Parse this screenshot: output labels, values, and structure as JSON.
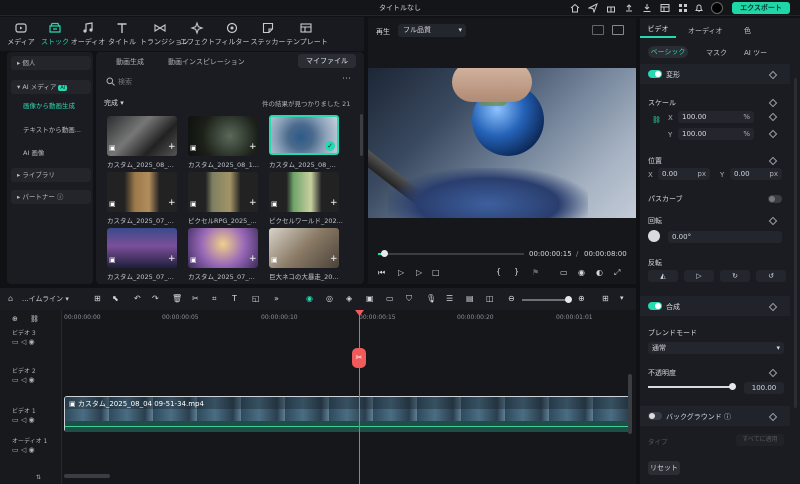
{
  "app": {
    "title": "タイトルなし",
    "export_label": "エクスポート"
  },
  "toolbar": {
    "tools": [
      {
        "label": "メディア",
        "icon": "media-icon"
      },
      {
        "label": "ストック",
        "icon": "stock-icon",
        "active": true
      },
      {
        "label": "オーディオ",
        "icon": "music-icon"
      },
      {
        "label": "タイトル",
        "icon": "title-icon"
      },
      {
        "label": "トランジション",
        "icon": "transition-icon"
      },
      {
        "label": "エフェクト",
        "icon": "effect-icon"
      },
      {
        "label": "フィルター",
        "icon": "filter-icon"
      },
      {
        "label": "ステッカー",
        "icon": "sticker-icon"
      },
      {
        "label": "テンプレート",
        "icon": "template-icon"
      }
    ]
  },
  "left_panel": {
    "items": [
      {
        "label": "個人",
        "type": "header"
      },
      {
        "label": "AI メディア",
        "badge": "AI",
        "type": "header"
      },
      {
        "label": "画像から動画生成",
        "type": "sub",
        "active": true
      },
      {
        "label": "テキストから動画...",
        "type": "sub"
      },
      {
        "label": "AI 画像",
        "type": "sub"
      },
      {
        "label": "ライブラリ",
        "type": "header"
      },
      {
        "label": "パートナー",
        "type": "header"
      }
    ]
  },
  "media_panel": {
    "tabs": [
      "動画生成",
      "動画インスピレーション",
      "マイファイル"
    ],
    "search_placeholder": "検索",
    "section_title": "完成",
    "result_count": "件の結果が見つかりました 21",
    "items": [
      {
        "label": "カスタム_2025_08_..."
      },
      {
        "label": "カスタム_2025_08_1..."
      },
      {
        "label": "カスタム_2025_08_..."
      },
      {
        "label": "カスタム_2025_07_..."
      },
      {
        "label": "ピクセルRPG_2025_..."
      },
      {
        "label": "ピクセルワールド_202..."
      },
      {
        "label": "カスタム_2025_07_..."
      },
      {
        "label": "カスタム_2025_07_..."
      },
      {
        "label": "巨大ネコの大暴走_20..."
      }
    ]
  },
  "player": {
    "play_label": "再生",
    "quality": "フル品質",
    "current_time": "00:00:00:15",
    "total_time": "00:00:08:00",
    "progress": 0.04
  },
  "properties": {
    "tabs": [
      "ビデオ",
      "オーディオ",
      "色"
    ],
    "subtabs": [
      "ベーシック",
      "マスク",
      "AI ツー"
    ],
    "transform": {
      "title": "変形",
      "scale_label": "スケール",
      "x_label": "X",
      "x_value": "100.00",
      "x_unit": "%",
      "y_label": "Y",
      "y_value": "100.00",
      "y_unit": "%",
      "position_label": "位置",
      "pos_x_label": "X",
      "pos_x": "0.00",
      "pos_x_unit": "px",
      "pos_y_label": "Y",
      "pos_y": "0.00",
      "pos_y_unit": "px",
      "path_curve_label": "パスカーブ",
      "rotate_label": "回転",
      "rotate_value": "0.00°",
      "flip_label": "反転"
    },
    "composite": {
      "title": "合成",
      "blend_label": "ブレンドモード",
      "blend_value": "通常",
      "opacity_label": "不透明度",
      "opacity_value": "100.00",
      "opacity_level": 1.0
    },
    "background": {
      "title": "バックグラウンド",
      "type_label": "タイプ",
      "apply_all": "すべてに適用"
    },
    "reset_label": "リセット"
  },
  "timeline": {
    "mode_label": "...イムライン",
    "ruler": [
      "00:00:00:00",
      "00:00:00:05",
      "00:00:00:10",
      "00:00:00:15",
      "00:00:00:20",
      "00:00:01:01"
    ],
    "tracks": [
      {
        "label": "ビデオ 3"
      },
      {
        "label": "ビデオ 2"
      },
      {
        "label": "ビデオ 1"
      },
      {
        "label": "オーディオ 1"
      }
    ],
    "clip_label": "カスタム_2025_08_04 09-51-34.mp4"
  },
  "colors": {
    "accent": "#26d9b0",
    "playhead": "#f05a5a",
    "export": "#1fd6a6"
  }
}
